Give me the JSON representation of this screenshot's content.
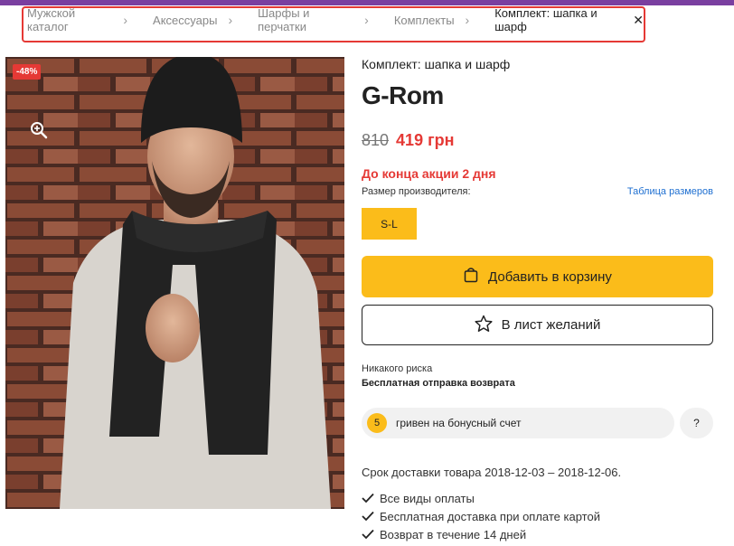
{
  "breadcrumb": {
    "items": [
      {
        "label": "Мужской каталог"
      },
      {
        "label": "Аксессуары"
      },
      {
        "label": "Шарфы и перчатки"
      },
      {
        "label": "Комплекты"
      }
    ],
    "current": "Комплект: шапка и шарф",
    "separator": "›",
    "close": "✕"
  },
  "image": {
    "discount_badge": "-48%",
    "zoom_icon": "zoom-in-icon"
  },
  "product": {
    "subtitle": "Комплект: шапка и шарф",
    "brand": "G-Rom",
    "old_price": "810",
    "new_price": "419 грн",
    "promo": "До конца акции 2 дня",
    "size_label": "Размер производителя:",
    "size_table_link": "Таблица размеров",
    "size_option": "S-L"
  },
  "actions": {
    "add_to_cart": "Добавить в корзину",
    "wishlist": "В лист желаний"
  },
  "returns": {
    "no_risk": "Никакого риска",
    "free_return": "Бесплатная отправка возврата"
  },
  "bonus": {
    "amount": "5",
    "text": "гривен на бонусный счет",
    "help": "?"
  },
  "delivery": {
    "text": "Срок доставки товара 2018-12-03 – 2018-12-06.",
    "features": [
      "Все виды оплаты",
      "Бесплатная доставка при оплате картой",
      "Возврат в течение 14 дней"
    ]
  },
  "colors": {
    "accent_yellow": "#fbbc1a",
    "sale_red": "#e53935",
    "link_blue": "#1e6fd1",
    "highlight_border": "#e53935"
  }
}
